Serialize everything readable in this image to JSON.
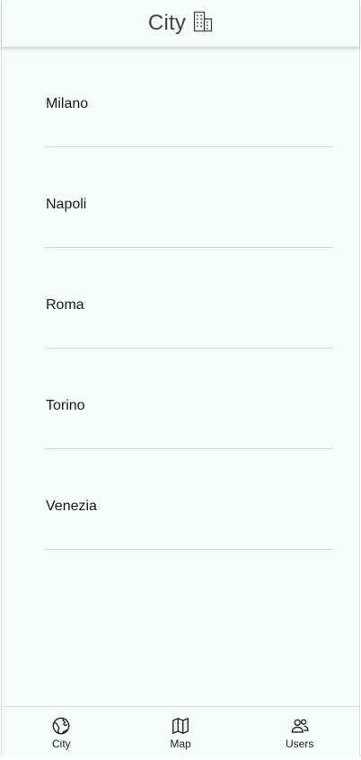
{
  "header": {
    "title": "City",
    "icon": "building-icon"
  },
  "cities": [
    {
      "name": "Milano"
    },
    {
      "name": "Napoli"
    },
    {
      "name": "Roma"
    },
    {
      "name": "Torino"
    },
    {
      "name": "Venezia"
    }
  ],
  "tabbar": {
    "tabs": [
      {
        "label": "City",
        "icon": "globe-icon"
      },
      {
        "label": "Map",
        "icon": "map-icon"
      },
      {
        "label": "Users",
        "icon": "users-icon"
      }
    ]
  },
  "colors": {
    "background": "#f5fffa",
    "text": "#1a1a1a",
    "title": "#444444",
    "divider": "#d5d5d5"
  }
}
